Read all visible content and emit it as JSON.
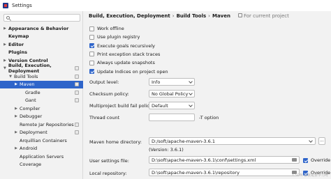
{
  "window": {
    "title": "Settings"
  },
  "sidebar": {
    "search_placeholder": "",
    "items": [
      {
        "label": "Appearance & Behavior",
        "arrow": "▶",
        "bold": true
      },
      {
        "label": "Keymap",
        "arrow": "",
        "bold": true
      },
      {
        "label": "Editor",
        "arrow": "▶",
        "bold": true
      },
      {
        "label": "Plugins",
        "arrow": "",
        "bold": true
      },
      {
        "label": "Version Control",
        "arrow": "▶",
        "bold": true
      },
      {
        "label": "Build, Execution, Deployment",
        "arrow": "▼",
        "bold": true
      },
      {
        "label": "Build Tools",
        "arrow": "▼",
        "bold": false
      },
      {
        "label": "Maven",
        "arrow": "▶",
        "bold": false,
        "selected": true
      },
      {
        "label": "Gradle",
        "arrow": "",
        "bold": false
      },
      {
        "label": "Gant",
        "arrow": "",
        "bold": false
      },
      {
        "label": "Compiler",
        "arrow": "▶",
        "bold": false
      },
      {
        "label": "Debugger",
        "arrow": "▶",
        "bold": false
      },
      {
        "label": "Remote Jar Repositories",
        "arrow": "",
        "bold": false
      },
      {
        "label": "Deployment",
        "arrow": "▶",
        "bold": false
      },
      {
        "label": "Arquillian Containers",
        "arrow": "",
        "bold": false
      },
      {
        "label": "Android",
        "arrow": "▶",
        "bold": false
      },
      {
        "label": "Application Servers",
        "arrow": "",
        "bold": false
      },
      {
        "label": "Coverage",
        "arrow": "",
        "bold": false
      }
    ]
  },
  "breadcrumb": {
    "part1": "Build, Execution, Deployment",
    "part2": "Build Tools",
    "part3": "Maven",
    "separator": "›",
    "note": "For current project"
  },
  "options": [
    {
      "label": "Work offline",
      "checked": false
    },
    {
      "label": "Use plugin registry",
      "checked": false
    },
    {
      "label": "Execute goals recursively",
      "checked": true
    },
    {
      "label": "Print exception stack traces",
      "checked": false
    },
    {
      "label": "Always update snapshots",
      "checked": false
    },
    {
      "label": "Update Indices on project open",
      "checked": true
    }
  ],
  "output_level": {
    "label": "Output level:",
    "value": "Info"
  },
  "checksum_policy": {
    "label": "Checksum policy:",
    "value": "No Global Policy"
  },
  "multiproject_fail_policy": {
    "label": "Multiproject build fail policy:",
    "value": "Default"
  },
  "thread_count": {
    "label": "Thread count",
    "value": "",
    "suffix": "-T option"
  },
  "maven_home": {
    "label": "Maven home directory:",
    "value": "D:/soft/apache-maven-3.6.1",
    "version": "(Version: 3.6.1)",
    "browse": "..."
  },
  "user_settings": {
    "label": "User settings file:",
    "value": "D:\\soft\\apache-maven-3.6.1\\conf\\settings.xml",
    "override": "Override",
    "override_checked": true
  },
  "local_repo": {
    "label": "Local repository:",
    "value": "D:\\soft\\apache-maven-3.6.1\\repository",
    "override": "Override",
    "override_checked": true
  },
  "watermark": "CSDN @就是要学习呀",
  "colors": {
    "selection": "#2f65ca",
    "checkbox_checked": "#2f65ca"
  }
}
